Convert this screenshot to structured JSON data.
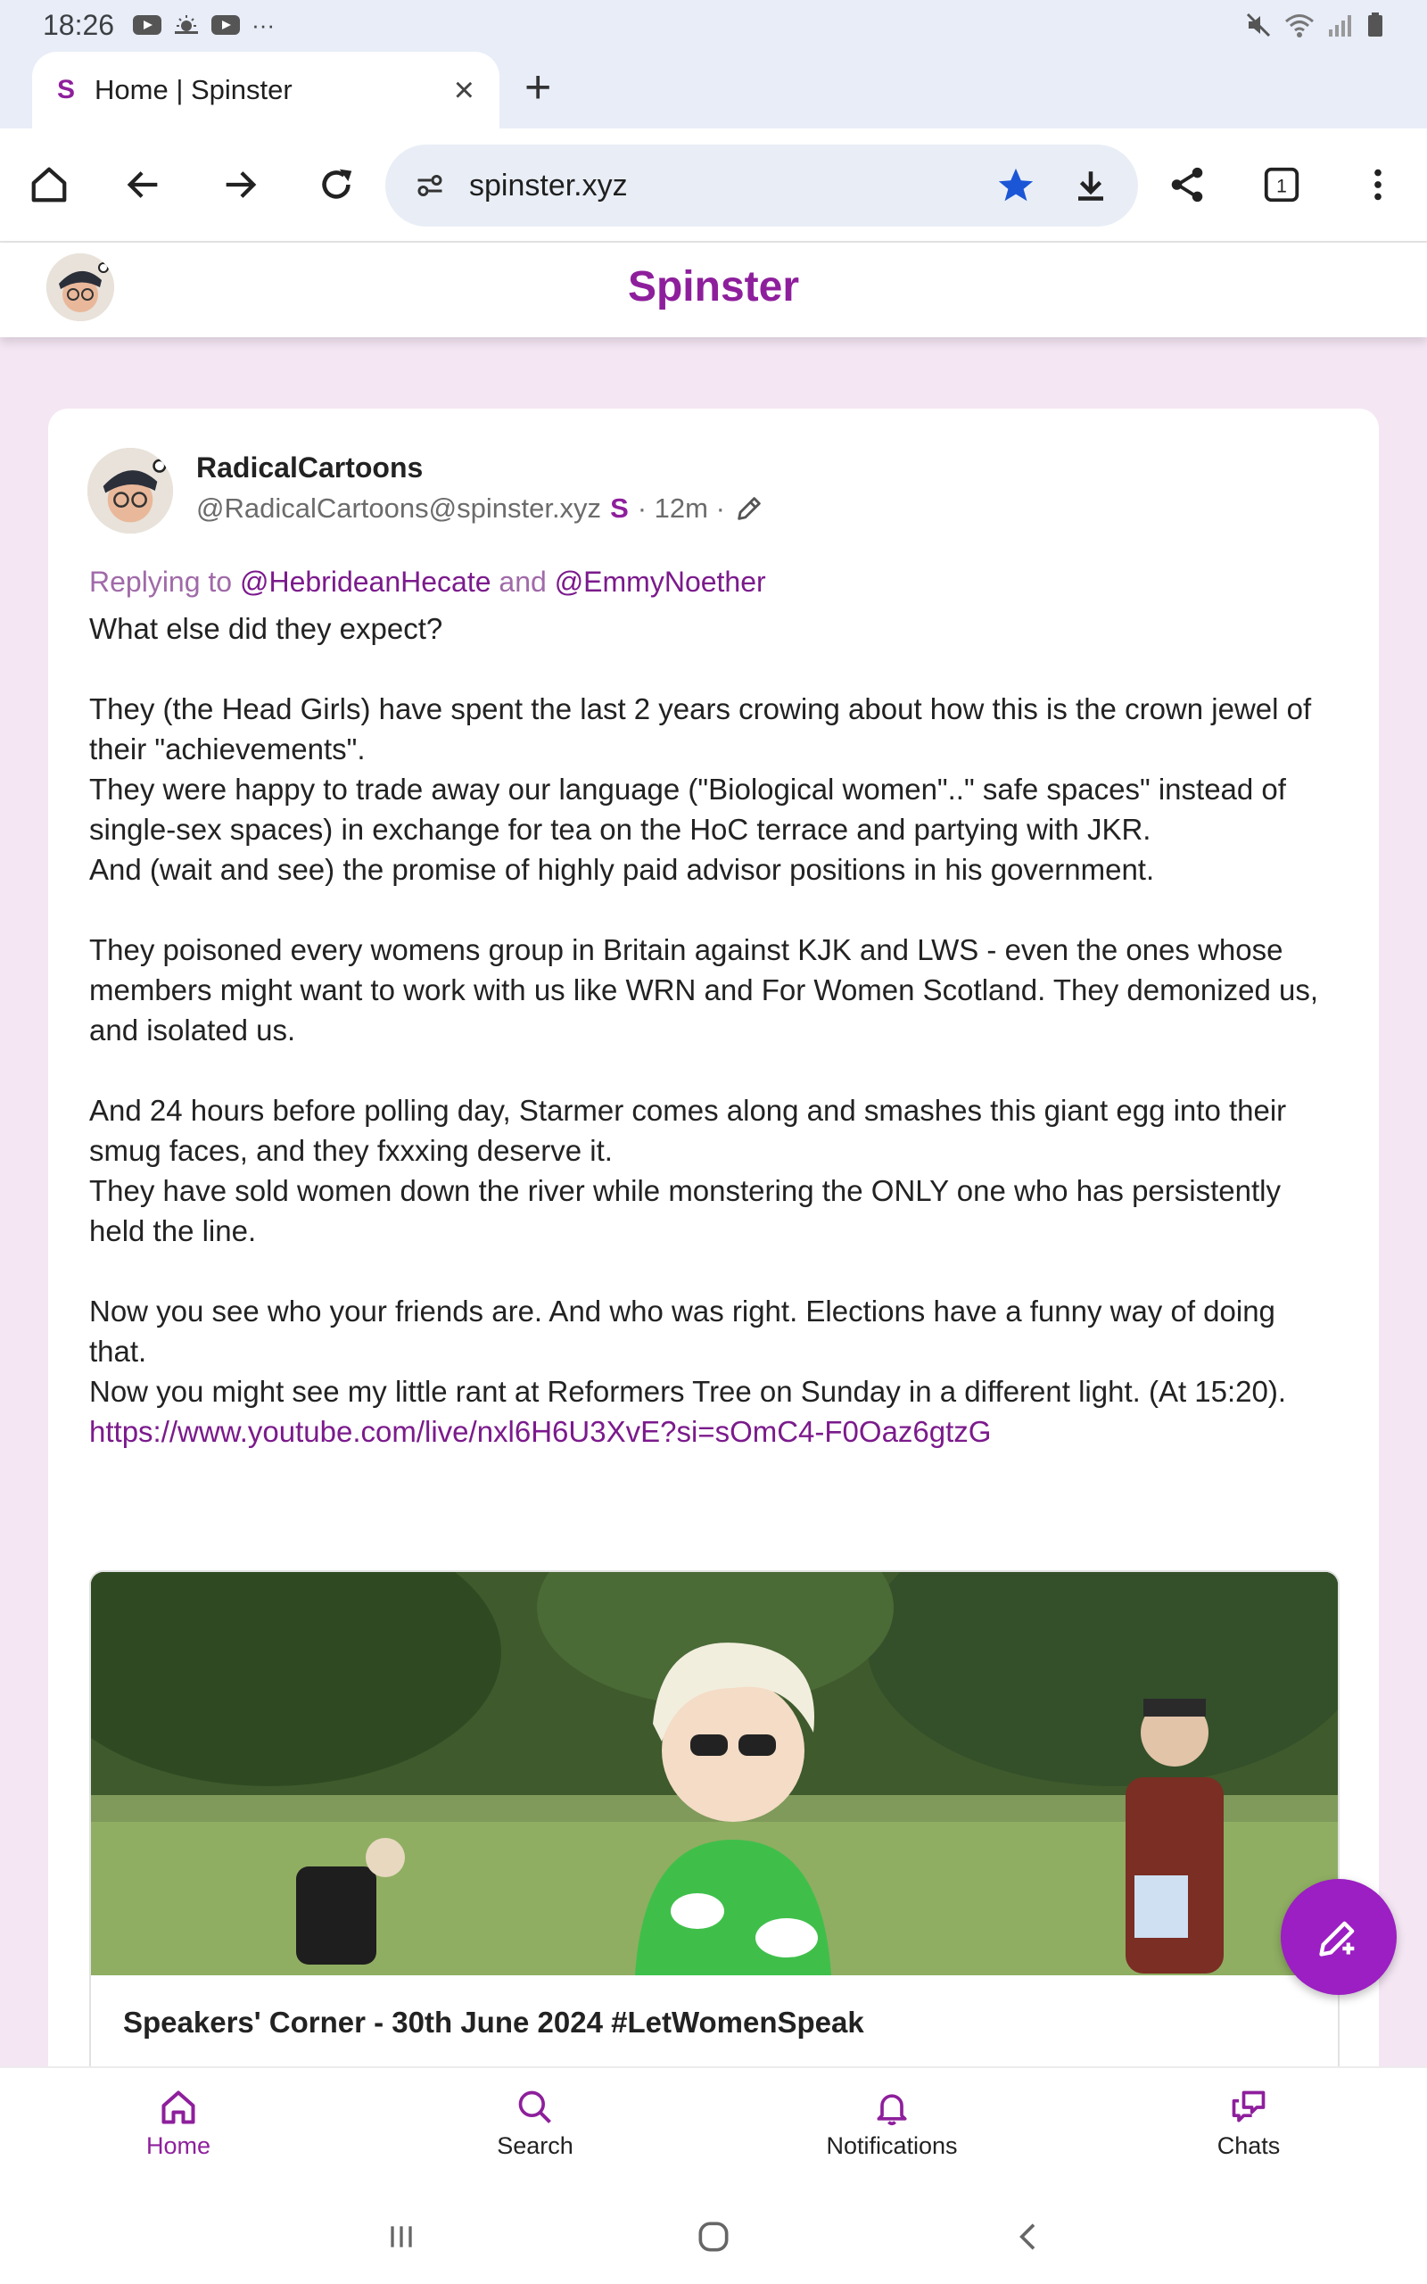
{
  "status_bar": {
    "time": "18:26",
    "more": "···"
  },
  "browser": {
    "tab": {
      "favicon": "S",
      "title": "Home | Spinster"
    },
    "url": "spinster.xyz",
    "tab_count": "1"
  },
  "site": {
    "brand": "Spinster"
  },
  "post": {
    "author_name": "RadicalCartoons",
    "author_handle": "@RadicalCartoons@spinster.xyz",
    "instance_badge": "S",
    "time": "· 12m ·",
    "replying_prefix": "Replying to",
    "mention_1": "@HebrideanHecate",
    "replying_and": "and",
    "mention_2": "@EmmyNoether",
    "paragraphs": [
      "What else did they expect?",
      "",
      "They (the Head Girls) have spent the last 2 years crowing about how this is the crown jewel of their \"achievements\".",
      "They were happy to trade away our language (\"Biological women\"..\" safe spaces\" instead of single-sex spaces) in exchange for tea on the HoC terrace and partying with JKR.",
      "And (wait and see) the promise of highly paid advisor positions in his government.",
      "",
      "They poisoned every womens group in Britain against KJK and LWS - even the ones whose members might want to work with us like WRN and For Women Scotland. They demonized us, and isolated us.",
      "",
      "And 24 hours before polling day, Starmer comes along and smashes this giant egg into their smug faces, and they fxxxing deserve it.",
      "They have sold women down the river while monstering the ONLY one who has persistently held the line.",
      "",
      "Now you see who your friends are. And who was right. Elections have a funny way of doing that.",
      "Now you might see my little rant at Reformers Tree on Sunday in a different light. (At 15:20)."
    ],
    "link": "https://www.youtube.com/live/nxl6H6U3XvE?si=sOmC4-F0Oaz6gtzG",
    "preview_title": "Speakers' Corner - 30th June 2024 #LetWomenSpeak"
  },
  "bottom_nav": {
    "home": "Home",
    "search": "Search",
    "notifications": "Notifications",
    "chats": "Chats"
  },
  "colors": {
    "brand": "#8e1f9c",
    "fab": "#9b1fc2",
    "page_bg": "#f4e6f3",
    "link": "#7b1a8c"
  }
}
